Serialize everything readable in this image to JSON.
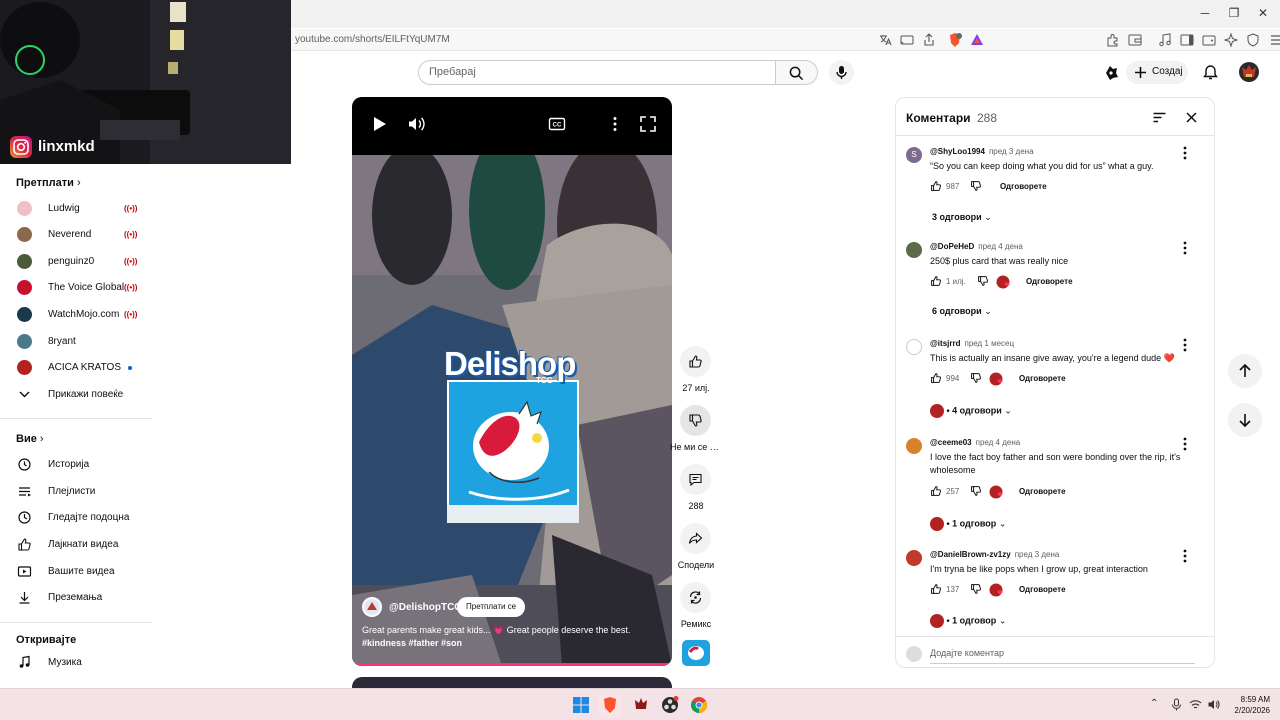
{
  "browser": {
    "url": "youtube.com/shorts/EILFtYqUM7M"
  },
  "overlay": {
    "instagram_handle": "linxmkd"
  },
  "header": {
    "search_placeholder": "Пребарај",
    "create_label": "Создај"
  },
  "sidebar": {
    "subscriptions_title": "Претплати",
    "subscriptions": [
      {
        "name": "Ludwig",
        "status": "live",
        "color": "#f0c0c8"
      },
      {
        "name": "Neverend",
        "status": "live",
        "color": "#8a6a4a"
      },
      {
        "name": "penguinz0",
        "status": "live",
        "color": "#4a5a3a"
      },
      {
        "name": "The Voice Global",
        "status": "live",
        "color": "#c8102e"
      },
      {
        "name": "WatchMojo.com",
        "status": "live",
        "color": "#1a3a4a"
      },
      {
        "name": "8ryant",
        "status": "none",
        "color": "#4a7a8a"
      },
      {
        "name": "ACICA KRATOS",
        "status": "new",
        "color": "#b22222"
      }
    ],
    "show_more": "Прикажи повеќе",
    "you_title": "Вие",
    "you_items": [
      {
        "label": "Историја",
        "icon": "history-icon"
      },
      {
        "label": "Плејлисти",
        "icon": "playlists-icon"
      },
      {
        "label": "Гледајте подоцна",
        "icon": "watch-later-icon"
      },
      {
        "label": "Лајкнати видеа",
        "icon": "liked-icon"
      },
      {
        "label": "Вашите видеа",
        "icon": "your-videos-icon"
      },
      {
        "label": "Преземања",
        "icon": "download-icon"
      }
    ],
    "explore_title": "Откривајте",
    "explore_items": [
      {
        "label": "Музика",
        "icon": "music-icon"
      }
    ]
  },
  "video": {
    "overlay_logo": "Delishop",
    "overlay_logo_sub": "TCG",
    "channel": "@DelishopTCG",
    "subscribe_label": "Претплати се",
    "caption_text": "Great parents make great kids... 💗 Great people deserve the best.",
    "caption_tags": "#kindness #father #son"
  },
  "actions": {
    "likes": "27 илј.",
    "dislike": "Не ми се допаѓа",
    "comments": "288",
    "share": "Сподели",
    "remix": "Ремикс"
  },
  "comments": {
    "title": "Коментари",
    "count": "288",
    "reply_label": "Одговорете",
    "add_placeholder": "Додајте коментар",
    "items": [
      {
        "user": "@ShyLoo1994",
        "time": "пред 3 дена",
        "text": "“So you can keep doing what you did for us” what a guy.",
        "likes": "987",
        "creator_heart": false,
        "replies": "3 одговори",
        "initial": "S",
        "color": "#7e6b8f"
      },
      {
        "user": "@DoPeHeD",
        "time": "пред 4 дена",
        "text": "250$ plus card that was really nice",
        "likes": "1 илј.",
        "creator_heart": true,
        "replies": "6 одговори",
        "initial": "",
        "color": "#5a6a4a"
      },
      {
        "user": "@itsjrrd",
        "time": "пред 1 месец",
        "text": "This is actually an insane give away, you're a legend dude ❤️",
        "likes": "994",
        "creator_heart": true,
        "replies": "4 одговори",
        "initial": "",
        "color": "#9a9a9a"
      },
      {
        "user": "@ceeme03",
        "time": "пред 4 дена",
        "text": "I love the fact boy father and son were bonding over the rip, it's wholesome",
        "likes": "257",
        "creator_heart": true,
        "replies": "1 одговор",
        "initial": "",
        "color": "#d9822b"
      },
      {
        "user": "@DanielBrown-zv1zy",
        "time": "пред 3 дена",
        "text": "I'm tryna be like pops when I grow up, great interaction",
        "likes": "137",
        "creator_heart": true,
        "replies": "1 одговор",
        "initial": "",
        "color": "#c0392b"
      }
    ]
  },
  "taskbar": {
    "time": "8:59 AM",
    "date": "2/20/2026"
  }
}
